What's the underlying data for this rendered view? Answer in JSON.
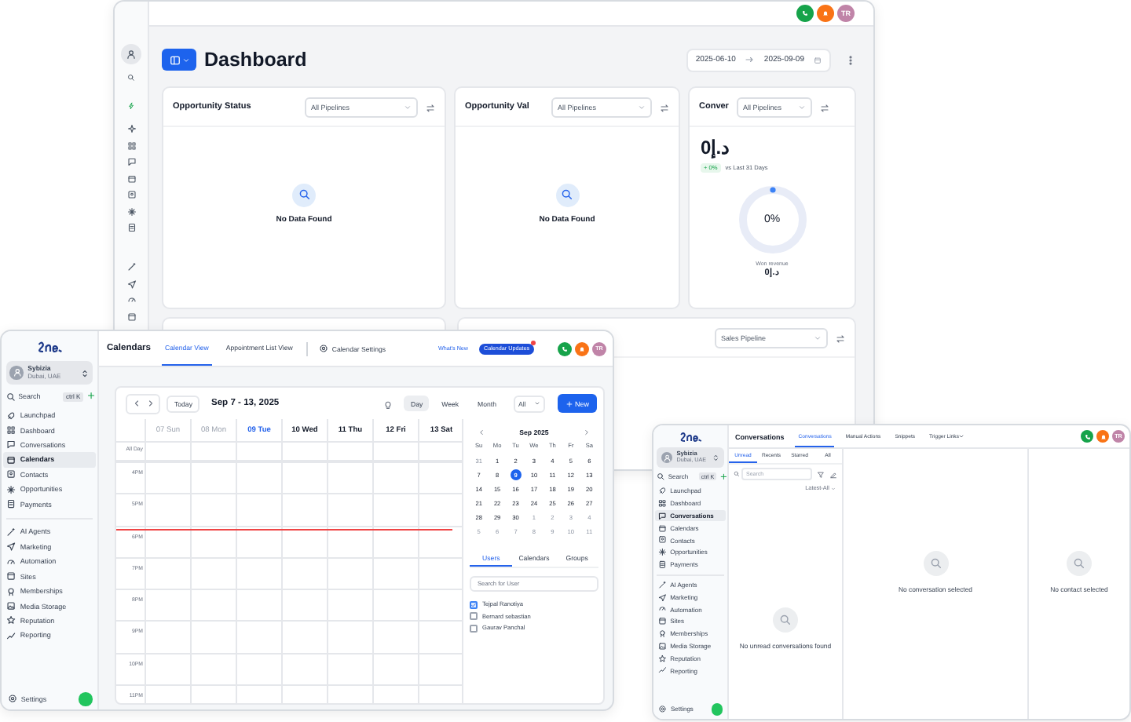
{
  "dashboard_window": {
    "avatar": "TR",
    "title": "Dashboard",
    "date_from": "2025-06-10",
    "date_to": "2025-09-09",
    "cards": [
      {
        "kind": "empty",
        "title": "Opportunity Status",
        "pipeline": "All Pipelines",
        "empty_text": "No Data Found"
      },
      {
        "kind": "empty",
        "title": "Opportunity Val",
        "pipeline": "All Pipelines",
        "empty_text": "No Data Found"
      },
      {
        "kind": "revenue",
        "title": "Conver",
        "pipeline": "All Pipelines",
        "amount": "د.إ0",
        "change": "+ 0%",
        "comparison": "vs Last 31 Days",
        "donut_label": "0%",
        "level": 0,
        "caption": "Won revenue",
        "caption_value": "د.إ0"
      }
    ],
    "lower_card": {
      "pipeline": "Sales Pipeline"
    }
  },
  "calendar_window": {
    "sidebar": {
      "account_name": "Sybizia",
      "account_location": "Dubai, UAE",
      "search_placeholder": "Search",
      "shortcut": "ctrl K",
      "nav": [
        {
          "label": "Launchpad",
          "selected": false
        },
        {
          "label": "Dashboard",
          "selected": false
        },
        {
          "label": "Conversations",
          "selected": false
        },
        {
          "label": "Calendars",
          "selected": true
        },
        {
          "label": "Contacts",
          "selected": false
        },
        {
          "label": "Opportunities",
          "selected": false
        },
        {
          "label": "Payments",
          "selected": false
        }
      ],
      "nav_more": [
        {
          "label": "AI Agents",
          "selected": false
        },
        {
          "label": "Marketing",
          "selected": false
        },
        {
          "label": "Automation",
          "selected": false
        },
        {
          "label": "Sites",
          "selected": false
        },
        {
          "label": "Memberships",
          "selected": false
        },
        {
          "label": "Media Storage",
          "selected": false
        },
        {
          "label": "Reputation",
          "selected": false
        },
        {
          "label": "Reporting",
          "selected": false
        }
      ],
      "settings": "Settings"
    },
    "title": "Calendars",
    "tabs": [
      {
        "label": "Calendar View",
        "selected": true
      },
      {
        "label": "Appointment List View",
        "selected": false
      }
    ],
    "settings_link": "Calendar Settings",
    "whats_new": "What's New",
    "updates_badge": "Calendar Updates",
    "avatar": "TR",
    "toolbar": {
      "today": "Today",
      "range": "Sep 7 - 13, 2025",
      "views": [
        {
          "label": "Day",
          "selected": true
        },
        {
          "label": "Week",
          "selected": false
        },
        {
          "label": "Month",
          "selected": false
        }
      ],
      "filter": "All",
      "new_button": "New"
    },
    "all_day": "All Day",
    "days": [
      {
        "label": "07 Sun",
        "kind": "past"
      },
      {
        "label": "08 Mon",
        "kind": "past"
      },
      {
        "label": "09 Tue",
        "kind": "today"
      },
      {
        "label": "10 Wed",
        "kind": "future"
      },
      {
        "label": "11 Thu",
        "kind": "future"
      },
      {
        "label": "12 Fri",
        "kind": "future"
      },
      {
        "label": "13 Sat",
        "kind": "future"
      }
    ],
    "hours": [
      "4PM",
      "5PM",
      "6PM",
      "7PM",
      "8PM",
      "9PM",
      "10PM",
      "11PM"
    ],
    "mini_calendar": {
      "month": "Sep 2025",
      "weekdays": [
        "Su",
        "Mo",
        "Tu",
        "We",
        "Th",
        "Fr",
        "Sa"
      ],
      "weeks": [
        [
          {
            "label": "31",
            "in_month": false,
            "selected": false
          },
          {
            "label": "1",
            "in_month": true,
            "selected": false
          },
          {
            "label": "2",
            "in_month": true,
            "selected": false
          },
          {
            "label": "3",
            "in_month": true,
            "selected": false
          },
          {
            "label": "4",
            "in_month": true,
            "selected": false
          },
          {
            "label": "5",
            "in_month": true,
            "selected": false
          },
          {
            "label": "6",
            "in_month": true,
            "selected": false
          }
        ],
        [
          {
            "label": "7",
            "in_month": true,
            "selected": false
          },
          {
            "label": "8",
            "in_month": true,
            "selected": false
          },
          {
            "label": "9",
            "in_month": true,
            "selected": true
          },
          {
            "label": "10",
            "in_month": true,
            "selected": false
          },
          {
            "label": "11",
            "in_month": true,
            "selected": false
          },
          {
            "label": "12",
            "in_month": true,
            "selected": false
          },
          {
            "label": "13",
            "in_month": true,
            "selected": false
          }
        ],
        [
          {
            "label": "14",
            "in_month": true,
            "selected": false
          },
          {
            "label": "15",
            "in_month": true,
            "selected": false
          },
          {
            "label": "16",
            "in_month": true,
            "selected": false
          },
          {
            "label": "17",
            "in_month": true,
            "selected": false
          },
          {
            "label": "18",
            "in_month": true,
            "selected": false
          },
          {
            "label": "19",
            "in_month": true,
            "selected": false
          },
          {
            "label": "20",
            "in_month": true,
            "selected": false
          }
        ],
        [
          {
            "label": "21",
            "in_month": true,
            "selected": false
          },
          {
            "label": "22",
            "in_month": true,
            "selected": false
          },
          {
            "label": "23",
            "in_month": true,
            "selected": false
          },
          {
            "label": "24",
            "in_month": true,
            "selected": false
          },
          {
            "label": "25",
            "in_month": true,
            "selected": false
          },
          {
            "label": "26",
            "in_month": true,
            "selected": false
          },
          {
            "label": "27",
            "in_month": true,
            "selected": false
          }
        ],
        [
          {
            "label": "28",
            "in_month": true,
            "selected": false
          },
          {
            "label": "29",
            "in_month": true,
            "selected": false
          },
          {
            "label": "30",
            "in_month": true,
            "selected": false
          },
          {
            "label": "1",
            "in_month": false,
            "selected": false
          },
          {
            "label": "2",
            "in_month": false,
            "selected": false
          },
          {
            "label": "3",
            "in_month": false,
            "selected": false
          },
          {
            "label": "4",
            "in_month": false,
            "selected": false
          }
        ],
        [
          {
            "label": "5",
            "in_month": false,
            "selected": false
          },
          {
            "label": "6",
            "in_month": false,
            "selected": false
          },
          {
            "label": "7",
            "in_month": false,
            "selected": false
          },
          {
            "label": "8",
            "in_month": false,
            "selected": false
          },
          {
            "label": "9",
            "in_month": false,
            "selected": false
          },
          {
            "label": "10",
            "in_month": false,
            "selected": false
          },
          {
            "label": "11",
            "in_month": false,
            "selected": false
          }
        ]
      ]
    },
    "user_tabs": [
      {
        "label": "Users",
        "selected": true
      },
      {
        "label": "Calendars",
        "selected": false
      },
      {
        "label": "Groups",
        "selected": false
      }
    ],
    "user_search": {
      "placeholder": "Search for User"
    },
    "users": [
      {
        "name": "Tejpal Ranotiya",
        "checked": true
      },
      {
        "name": "Bernard sebastian",
        "checked": false
      },
      {
        "name": "Gaurav Panchal",
        "checked": false
      }
    ]
  },
  "conversations_window": {
    "sidebar": {
      "account_name": "Sybizia",
      "account_location": "Dubai, UAE",
      "search_placeholder": "Search",
      "shortcut": "ctrl K",
      "nav": [
        {
          "label": "Launchpad",
          "selected": false
        },
        {
          "label": "Dashboard",
          "selected": false
        },
        {
          "label": "Conversations",
          "selected": true
        },
        {
          "label": "Calendars",
          "selected": false
        },
        {
          "label": "Contacts",
          "selected": false
        },
        {
          "label": "Opportunities",
          "selected": false
        },
        {
          "label": "Payments",
          "selected": false
        }
      ],
      "nav_more": [
        {
          "label": "AI Agents",
          "selected": false
        },
        {
          "label": "Marketing",
          "selected": false
        },
        {
          "label": "Automation",
          "selected": false
        },
        {
          "label": "Sites",
          "selected": false
        },
        {
          "label": "Memberships",
          "selected": false
        },
        {
          "label": "Media Storage",
          "selected": false
        },
        {
          "label": "Reputation",
          "selected": false
        },
        {
          "label": "Reporting",
          "selected": false
        }
      ],
      "settings": "Settings"
    },
    "title": "Conversations",
    "avatar": "TR",
    "tabs": [
      {
        "label": "Conversations",
        "selected": true
      },
      {
        "label": "Manual Actions",
        "selected": false
      },
      {
        "label": "Snippets",
        "selected": false
      },
      {
        "label": "Trigger Links",
        "selected": false
      }
    ],
    "subtabs": [
      {
        "label": "Unread",
        "selected": true
      },
      {
        "label": "Recents",
        "selected": false
      },
      {
        "label": "Starred",
        "selected": false
      },
      {
        "label": "All",
        "selected": false
      }
    ],
    "search": {
      "placeholder": "Search"
    },
    "sort": "Latest-All",
    "empty_list": "No unread conversations found",
    "empty_conversation": "No conversation selected",
    "empty_contact": "No contact selected"
  }
}
